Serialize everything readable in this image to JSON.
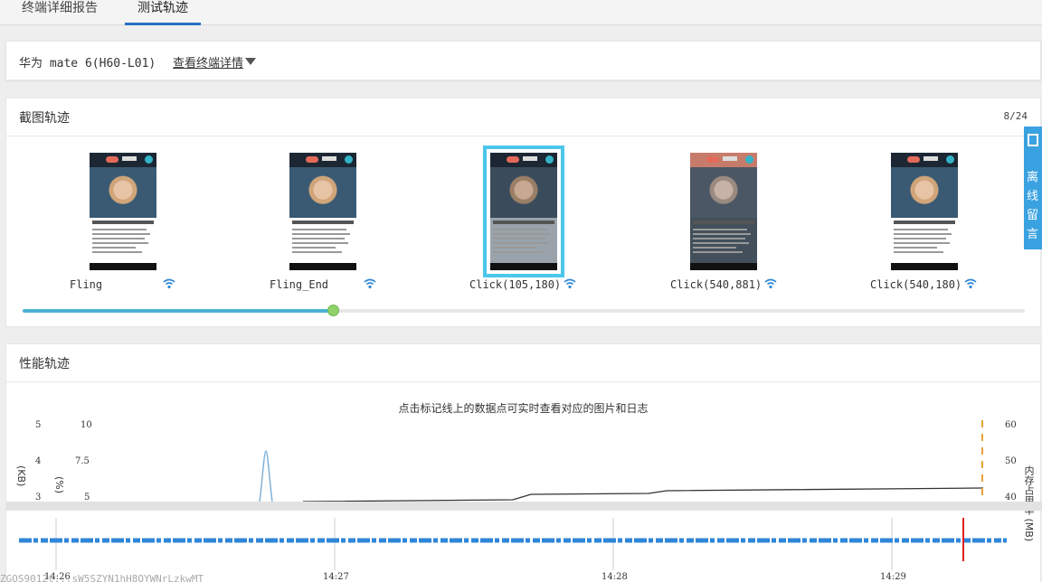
{
  "tabs": [
    {
      "label": "终端详细报告",
      "active": false
    },
    {
      "label": "测试轨迹",
      "active": true
    }
  ],
  "device": {
    "name": "华为 mate 6(H60-L01)",
    "details_link": "查看终端详情"
  },
  "screenshots": {
    "title": "截图轨迹",
    "counter": "8/24",
    "items": [
      {
        "label": "Fling",
        "variant": "normal"
      },
      {
        "label": "Fling_End",
        "variant": "normal"
      },
      {
        "label": "Click(105,180)",
        "variant": "dim",
        "active": true
      },
      {
        "label": "Click(540,881)",
        "variant": "follow"
      },
      {
        "label": "Click(540,180)",
        "variant": "normal"
      }
    ],
    "progress_fraction": 0.31
  },
  "performance": {
    "title": "性能轨迹",
    "hint": "点击标记线上的数据点可实时查看对应的图片和日志",
    "y_axis_kb_ticks": [
      "5",
      "4",
      "3"
    ],
    "y_axis_pct_ticks": [
      "10",
      "7.5",
      "5"
    ],
    "y_axis_mb_ticks": [
      "60",
      "50",
      "40"
    ],
    "y_axis_kb_label": "(KB)",
    "y_axis_pct_label": "(%)",
    "y_axis_right_label": "内存占用率 (MB)",
    "x_ticks": [
      "14:26",
      "14:27",
      "14:28",
      "14:29"
    ],
    "colors": {
      "cpu": "#7fb2d8",
      "memory": "#333333",
      "marker": "#e8a33a",
      "events": "#2f86d8",
      "cursor": "#e02020"
    }
  },
  "side_float": {
    "text": "离线留言"
  },
  "watermark": "ZGOS9012t...sW5SZYN1hH8QYWNrLzkwMT"
}
